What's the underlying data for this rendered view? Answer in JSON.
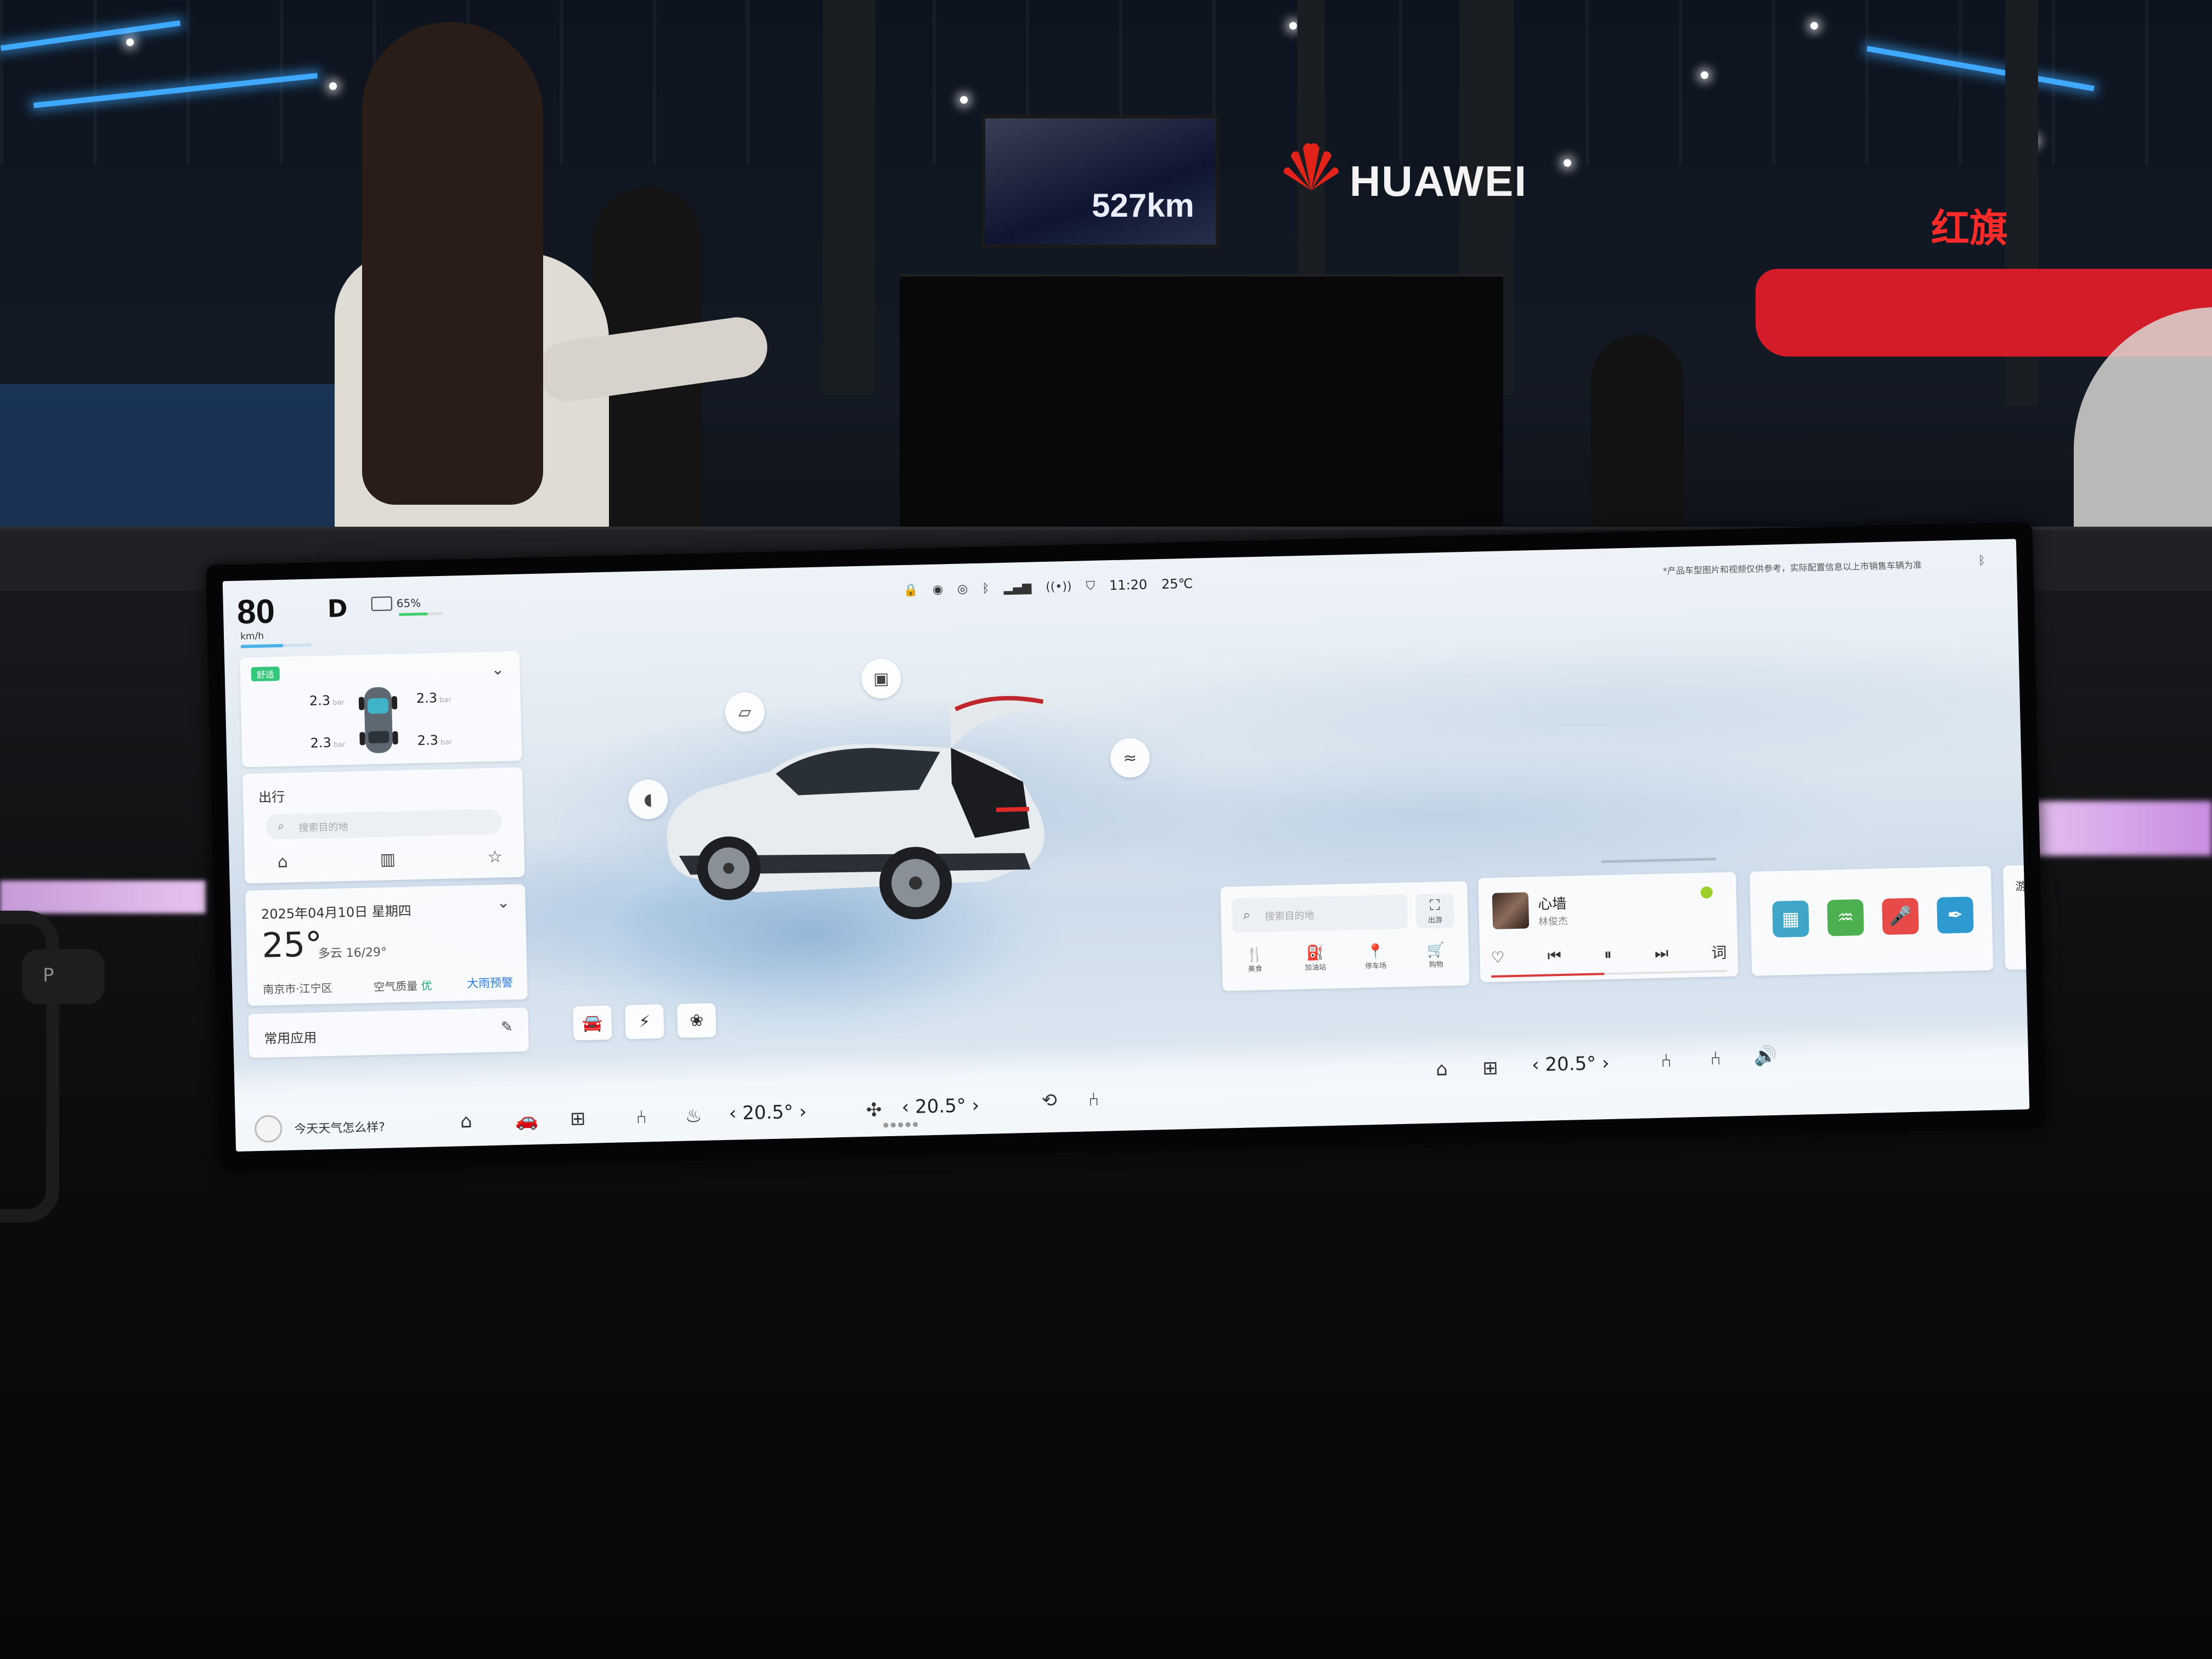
{
  "scene": {
    "booth_screen_text": "527km",
    "booth_brand": "HUAWEI",
    "red_booth_sign": "红旗"
  },
  "gear_stalk_label": "P",
  "status_bar": {
    "speed": "80",
    "speed_unit": "km/h",
    "gear": "D",
    "battery_percent": "65%",
    "battery_level": 0.65,
    "time": "11:20",
    "outside_temp": "25℃",
    "notice": "*产品车型图片和视频仅供参考，实际配置信息以上市销售车辆为准"
  },
  "tire_card": {
    "tag": "舒适",
    "fl": "2.3",
    "fr": "2.3",
    "rl": "2.3",
    "rr": "2.3",
    "unit": "bar"
  },
  "trip_card": {
    "title": "出行",
    "search_placeholder": "搜索目的地"
  },
  "weather_card": {
    "date": "2025年04月10日 星期四",
    "temp": "25°",
    "desc": "多云 16/29°",
    "location": "南京市·江宁区",
    "aqi_label": "空气质量",
    "aqi_value": "优",
    "alert": "大雨预警"
  },
  "apps_card": {
    "title": "常用应用"
  },
  "nav_widget": {
    "search_placeholder": "搜索目的地",
    "map_label": "出游",
    "shortcuts": [
      "美食",
      "加油站",
      "停车场",
      "购物"
    ]
  },
  "music_widget": {
    "song": "心墙",
    "artist": "林俊杰",
    "progress": 0.48
  },
  "games": {
    "label": "游戏"
  },
  "dock": {
    "assistant_prompt": "今天天气怎么样?",
    "driver_temp": "20.5°",
    "passenger_temp": "20.5°",
    "rear_temp": "20.5°"
  },
  "colors": {
    "accent_blue": "#2e7de0",
    "battery_green": "#3ccf6a",
    "music_red": "#d83a3a",
    "tag_green": "#34c77b"
  }
}
